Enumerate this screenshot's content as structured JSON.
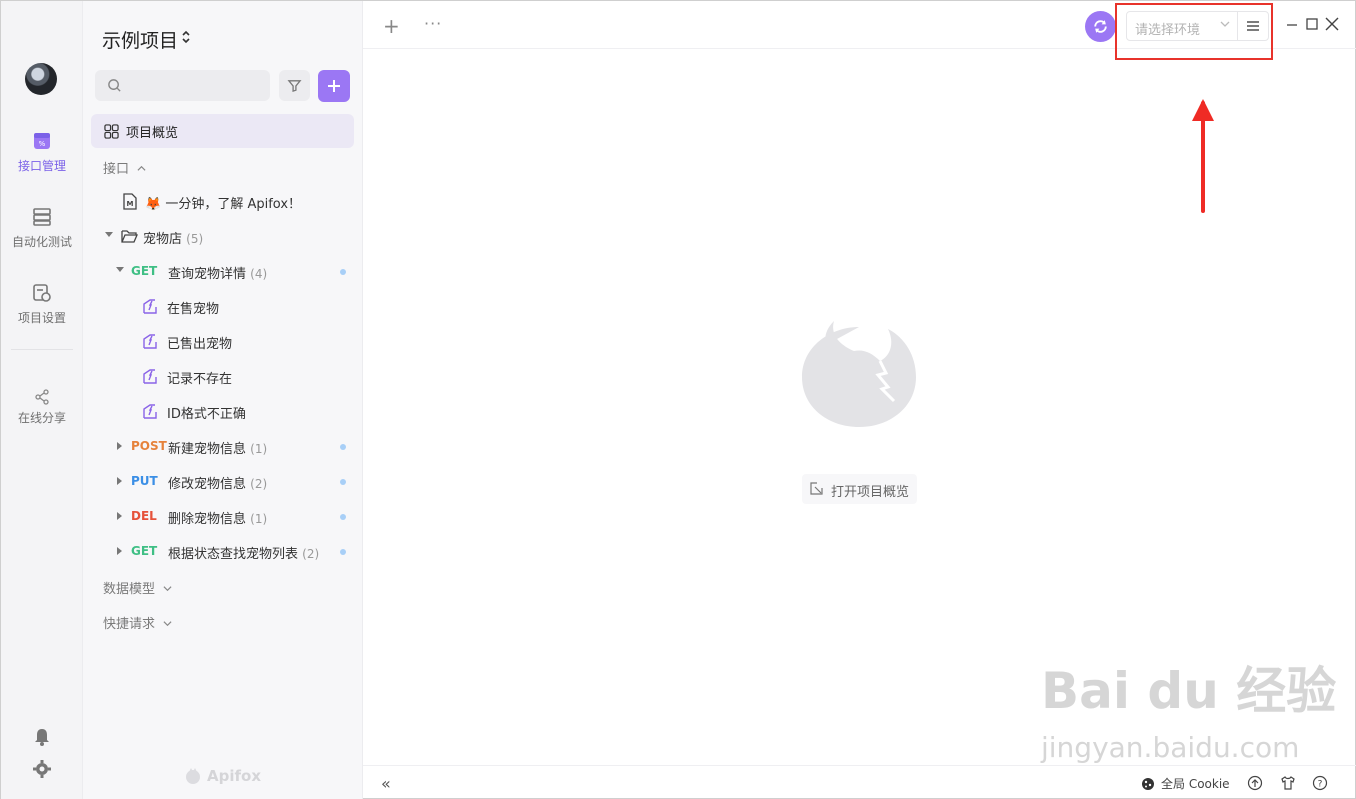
{
  "rail": {
    "items": [
      {
        "label": "接口管理",
        "icon": "api-management-icon",
        "active": true
      },
      {
        "label": "自动化测试",
        "icon": "automation-test-icon"
      },
      {
        "label": "项目设置",
        "icon": "project-settings-icon"
      },
      {
        "label": "在线分享",
        "icon": "share-icon"
      }
    ]
  },
  "sidebar": {
    "project_title": "示例项目",
    "overview_label": "项目概览",
    "section_api": "接口",
    "intro_doc": "🦊 一分钟，了解 Apifox！",
    "folder": {
      "name": "宠物店",
      "count": "(5)"
    },
    "endpoints": [
      {
        "method": "GET",
        "name": "查询宠物详情",
        "count": "(4)",
        "expanded": true,
        "cases": [
          "在售宠物",
          "已售出宠物",
          "记录不存在",
          "ID格式不正确"
        ]
      },
      {
        "method": "POST",
        "name": "新建宠物信息",
        "count": "(1)"
      },
      {
        "method": "PUT",
        "name": "修改宠物信息",
        "count": "(2)"
      },
      {
        "method": "DEL",
        "name": "删除宠物信息",
        "count": "(1)"
      },
      {
        "method": "GET",
        "name": "根据状态查找宠物列表",
        "count": "(2)"
      }
    ],
    "section_models": "数据模型",
    "section_quick": "快捷请求",
    "brand": "Apifox"
  },
  "topbar": {
    "env_placeholder": "请选择环境"
  },
  "main": {
    "open_overview": "打开项目概览"
  },
  "footer": {
    "cookie_label": "全局 Cookie"
  },
  "watermark": {
    "line1": "Bai du 经验",
    "line2": "jingyan.baidu.com"
  },
  "colors": {
    "accent": "#9b77f4",
    "get": "#3fbf85",
    "post": "#e6823b",
    "put": "#3b8fe6",
    "del": "#e6523b",
    "annotation": "#e8332b"
  }
}
